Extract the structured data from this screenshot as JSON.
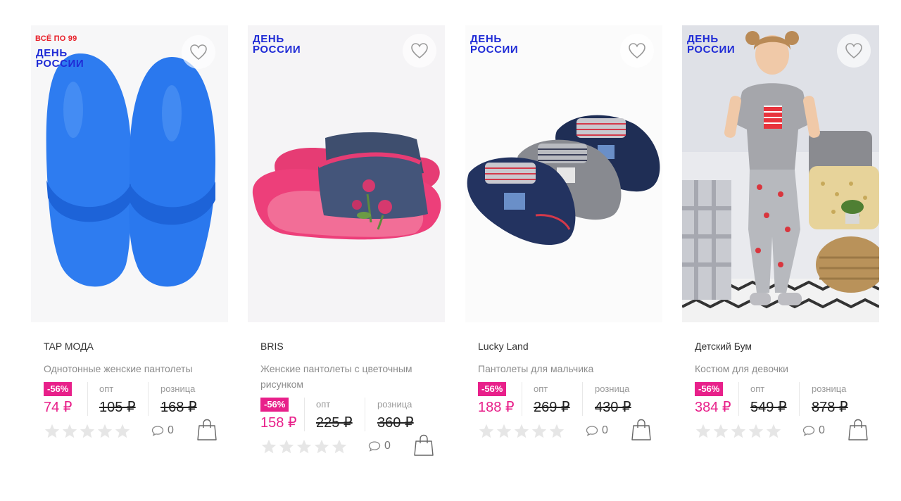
{
  "products": [
    {
      "sale_tag": "ВСЁ ПО 99",
      "promo": "ДЕНЬ\nРОССИИ",
      "brand": "TAP МОДА",
      "title": "Однотонные женские пантолеты",
      "discount": "-56%",
      "price": "74 ₽",
      "opt_label": "опт",
      "opt_price": "105 ₽",
      "retail_label": "розница",
      "retail_price": "168 ₽",
      "comments": "0"
    },
    {
      "promo": "ДЕНЬ\nРОССИИ",
      "brand": "BRIS",
      "title": "Женские пантолеты с цветочным рисунком",
      "discount": "-56%",
      "price": "158 ₽",
      "opt_label": "опт",
      "opt_price": "225 ₽",
      "retail_label": "розница",
      "retail_price": "360 ₽",
      "comments": "0"
    },
    {
      "promo": "ДЕНЬ\nРОССИИ",
      "brand": "Lucky Land",
      "title": "Пантолеты для мальчика",
      "discount": "-56%",
      "price": "188 ₽",
      "opt_label": "опт",
      "opt_price": "269 ₽",
      "retail_label": "розница",
      "retail_price": "430 ₽",
      "comments": "0"
    },
    {
      "promo": "ДЕНЬ\nРОССИИ",
      "brand": "Детский Бум",
      "title": "Костюм для девочки",
      "discount": "-56%",
      "price": "384 ₽",
      "opt_label": "опт",
      "opt_price": "549 ₽",
      "retail_label": "розница",
      "retail_price": "878 ₽",
      "comments": "0"
    }
  ],
  "rating": {
    "max_stars": 5,
    "value": 0
  },
  "icons": {
    "favorite": "heart-icon",
    "comments": "comment-icon",
    "cart": "shopping-bag-icon",
    "rating": "star-icon"
  },
  "colors": {
    "accent": "#e8208a",
    "promo": "#1f2bd6",
    "sale": "#e8202a",
    "star_empty": "#e6e6e6"
  }
}
